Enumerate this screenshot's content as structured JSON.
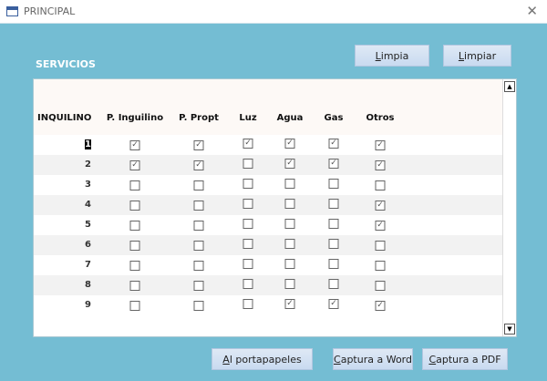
{
  "window": {
    "title": "PRINCIPAL",
    "close": "✕"
  },
  "section_label": "SERVICIOS",
  "buttons": {
    "limpia": "Limpia",
    "limpiar": "Limpiar",
    "portapapeles": "Al portapapeles",
    "word": "Captura a Word",
    "pdf": "Captura a PDF"
  },
  "table": {
    "headers": [
      "INQUILINO",
      "P. Inguilino",
      "P. Propt",
      "Luz",
      "Agua",
      "Gas",
      "Otros"
    ],
    "rows": [
      {
        "id": "1",
        "checks": [
          true,
          true,
          true,
          true,
          true,
          true
        ]
      },
      {
        "id": "2",
        "checks": [
          true,
          true,
          false,
          true,
          true,
          true
        ]
      },
      {
        "id": "3",
        "checks": [
          false,
          false,
          false,
          false,
          false,
          false
        ]
      },
      {
        "id": "4",
        "checks": [
          false,
          false,
          false,
          false,
          false,
          true
        ]
      },
      {
        "id": "5",
        "checks": [
          false,
          false,
          false,
          false,
          false,
          true
        ]
      },
      {
        "id": "6",
        "checks": [
          false,
          false,
          false,
          false,
          false,
          false
        ]
      },
      {
        "id": "7",
        "checks": [
          false,
          false,
          false,
          false,
          false,
          false
        ]
      },
      {
        "id": "8",
        "checks": [
          false,
          false,
          false,
          false,
          false,
          false
        ]
      },
      {
        "id": "9",
        "checks": [
          false,
          false,
          false,
          true,
          true,
          true
        ]
      }
    ]
  },
  "scroll": {
    "up": "▲",
    "down": "▼"
  }
}
